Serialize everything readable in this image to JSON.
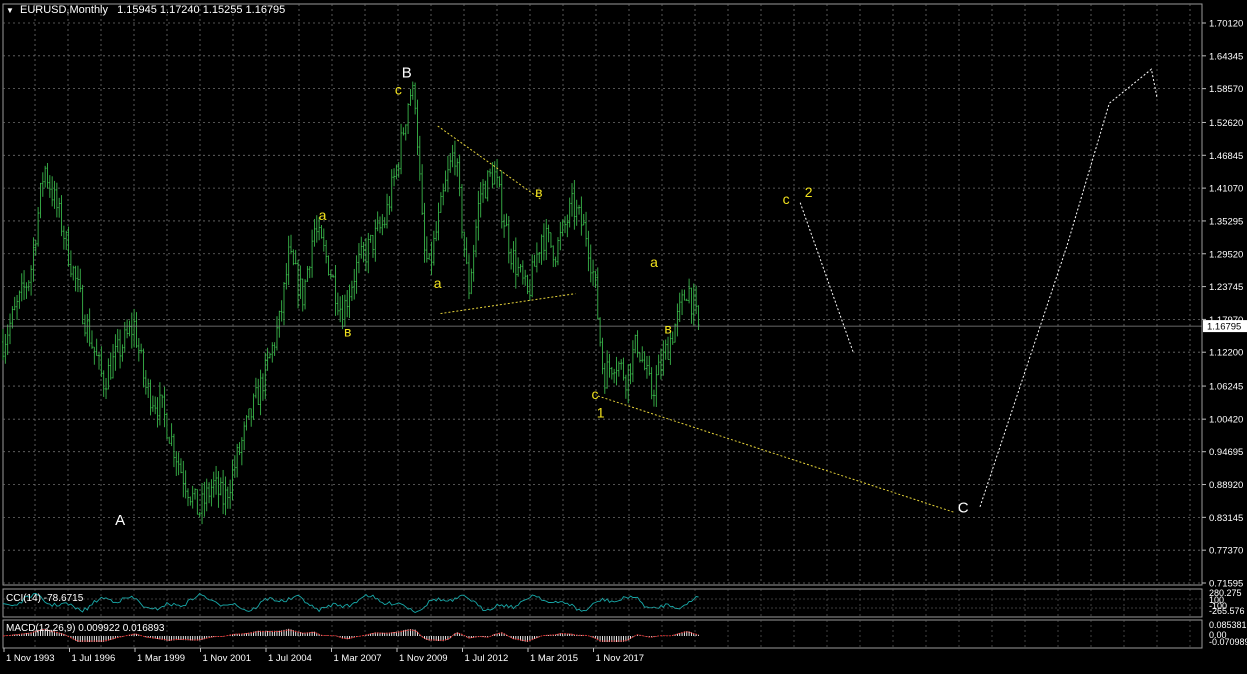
{
  "header": {
    "symbol": "EURUSD,Monthly",
    "ohlc": "1.15945 1.17240 1.15255 1.16795"
  },
  "colors": {
    "background": "#000000",
    "grid": "#6e6e6e",
    "candles": "#39b54a",
    "wave_labels_small": "#f2e21e",
    "wave_labels_major": "#ffffff",
    "yellow_dotted": "#e7d43a",
    "white_dotted": "#ffffff",
    "cci_line": "#17a8a8",
    "macd_hist": "#ffffff",
    "macd_signal": "#e23030",
    "price_marker_bg": "#ffffff",
    "price_marker_text": "#000000"
  },
  "chart_data": {
    "type": "candlestick",
    "symbol": "EURUSD",
    "timeframe": "Monthly",
    "ylim": [
      0.69,
      1.74
    ],
    "yticks": [
      "1.70120",
      "1.64345",
      "1.58570",
      "1.52620",
      "1.46845",
      "1.41070",
      "1.35295",
      "1.29520",
      "1.23745",
      "1.17970",
      "1.12200",
      "1.06245",
      "1.00420",
      "0.94695",
      "0.88920",
      "0.83145",
      "0.77370",
      "0.71595"
    ],
    "xticks": [
      "1 Nov 1993",
      "1 Jul 1996",
      "1 Mar 1999",
      "1 Nov 2001",
      "1 Jul 2004",
      "1 Mar 2007",
      "1 Nov 2009",
      "1 Jul 2012",
      "1 Mar 2015",
      "1 Nov 2017"
    ],
    "current_price": "1.16795",
    "price_path": [
      [
        1993.83,
        1.14
      ],
      [
        1994.8,
        1.26
      ],
      [
        1995.3,
        1.45
      ],
      [
        1995.9,
        1.35
      ],
      [
        1996.3,
        1.27
      ],
      [
        1996.8,
        1.17
      ],
      [
        1997.4,
        1.07
      ],
      [
        1997.9,
        1.12
      ],
      [
        1998.5,
        1.17
      ],
      [
        1998.9,
        1.06
      ],
      [
        1999.5,
        1.02
      ],
      [
        2000.2,
        0.91
      ],
      [
        2000.8,
        0.84
      ],
      [
        2001.3,
        0.89
      ],
      [
        2001.7,
        0.86
      ],
      [
        2002.5,
        0.99
      ],
      [
        2003.2,
        1.09
      ],
      [
        2003.7,
        1.18
      ],
      [
        2004.0,
        1.29
      ],
      [
        2004.5,
        1.22
      ],
      [
        2004.9,
        1.34
      ],
      [
        2005.4,
        1.28
      ],
      [
        2005.9,
        1.19
      ],
      [
        2006.4,
        1.27
      ],
      [
        2006.9,
        1.31
      ],
      [
        2007.4,
        1.35
      ],
      [
        2007.9,
        1.46
      ],
      [
        2008.3,
        1.58
      ],
      [
        2008.5,
        1.57
      ],
      [
        2008.8,
        1.3
      ],
      [
        2009.0,
        1.27
      ],
      [
        2009.6,
        1.42
      ],
      [
        2009.9,
        1.48
      ],
      [
        2010.4,
        1.23
      ],
      [
        2010.8,
        1.4
      ],
      [
        2011.3,
        1.44
      ],
      [
        2011.9,
        1.3
      ],
      [
        2012.5,
        1.22
      ],
      [
        2013.0,
        1.33
      ],
      [
        2013.5,
        1.3
      ],
      [
        2014.1,
        1.38
      ],
      [
        2014.6,
        1.33
      ],
      [
        2014.9,
        1.24
      ],
      [
        2015.2,
        1.08
      ],
      [
        2015.6,
        1.11
      ],
      [
        2016.0,
        1.08
      ],
      [
        2016.4,
        1.14
      ],
      [
        2016.9,
        1.05
      ],
      [
        2017.4,
        1.12
      ],
      [
        2017.9,
        1.19
      ],
      [
        2018.2,
        1.24
      ],
      [
        2018.6,
        1.16
      ]
    ],
    "wave_labels": [
      {
        "text": "A",
        "date": 1998.0,
        "price": 0.818,
        "major": true
      },
      {
        "text": "B",
        "date": 2008.2,
        "price": 1.605,
        "major": true
      },
      {
        "text": "C",
        "date": 2028.0,
        "price": 0.84,
        "major": true
      },
      {
        "text": "1",
        "date": 2015.1,
        "price": 1.007,
        "major": false
      },
      {
        "text": "2",
        "date": 2022.5,
        "price": 1.395,
        "major": false
      },
      {
        "text": "a",
        "date": 2005.2,
        "price": 1.355,
        "major": false
      },
      {
        "text": "в",
        "date": 2006.1,
        "price": 1.15,
        "major": false
      },
      {
        "text": "c",
        "date": 2007.9,
        "price": 1.575,
        "major": false
      },
      {
        "text": "a",
        "date": 2009.3,
        "price": 1.235,
        "major": false
      },
      {
        "text": "в",
        "date": 2012.9,
        "price": 1.395,
        "major": false
      },
      {
        "text": "c",
        "date": 2014.9,
        "price": 1.04,
        "major": false
      },
      {
        "text": "a",
        "date": 2017.0,
        "price": 1.272,
        "major": false
      },
      {
        "text": "в",
        "date": 2017.5,
        "price": 1.155,
        "major": false
      },
      {
        "text": "c",
        "date": 2021.7,
        "price": 1.383,
        "major": false
      }
    ],
    "yellow_lines": [
      [
        [
          2009.3,
          1.52
        ],
        [
          2013.0,
          1.39
        ]
      ],
      [
        [
          2009.4,
          1.19
        ],
        [
          2014.2,
          1.225
        ]
      ],
      [
        [
          2015.0,
          1.045
        ],
        [
          2027.7,
          0.84
        ]
      ]
    ],
    "white_dotted_path": [
      [
        2022.2,
        1.385
      ],
      [
        2024.1,
        1.12
      ]
    ],
    "white_dotted_path_2": [
      [
        2028.6,
        0.85
      ],
      [
        2031.7,
        1.31
      ],
      [
        2033.2,
        1.56
      ],
      [
        2034.7,
        1.62
      ],
      [
        2034.9,
        1.57
      ]
    ],
    "cci": {
      "label": "CCI(14) -78.6715",
      "scale": [
        "280.275",
        "100",
        "-100",
        "-265.576"
      ]
    },
    "macd": {
      "label": "MACD(12,26,9) 0.009922 0.016893",
      "scale": [
        "0.085381",
        "0.00",
        "-0.070989"
      ]
    }
  }
}
